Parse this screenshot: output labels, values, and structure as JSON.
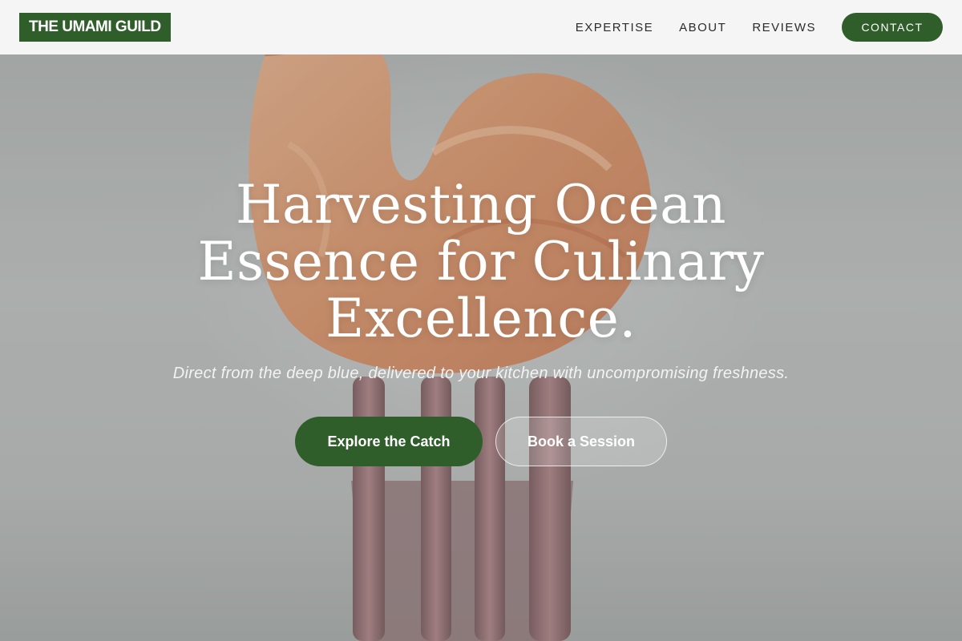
{
  "brand": {
    "name": "THE UMAMI GUILD",
    "accent_color": "#2f5e2b"
  },
  "nav": {
    "links": [
      {
        "label": "EXPERTISE"
      },
      {
        "label": "ABOUT"
      },
      {
        "label": "REVIEWS"
      }
    ],
    "contact_label": "CONTACT"
  },
  "hero": {
    "headline": "Harvesting Ocean Essence for Culinary Excellence.",
    "subtitle": "Direct from the deep blue, delivered to your kitchen with uncompromising freshness.",
    "primary_cta": "Explore the Catch",
    "secondary_cta": "Book a Session"
  }
}
